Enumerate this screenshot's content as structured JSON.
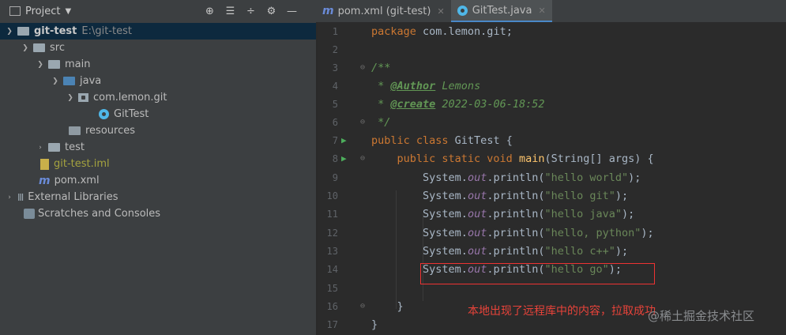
{
  "project_panel": {
    "title": "Project",
    "tools": [
      "⊕",
      "☰",
      "÷",
      "⚙",
      "—"
    ]
  },
  "tabs": [
    {
      "label": "pom.xml (git-test)",
      "active": false
    },
    {
      "label": "GitTest.java",
      "active": true
    }
  ],
  "tree": [
    {
      "label": "git-test",
      "extra": "E:\\git-test"
    },
    {
      "label": "src"
    },
    {
      "label": "main"
    },
    {
      "label": "java"
    },
    {
      "label": "com.lemon.git"
    },
    {
      "label": "GitTest"
    },
    {
      "label": "resources"
    },
    {
      "label": "test"
    },
    {
      "label": "git-test.iml"
    },
    {
      "label": "pom.xml"
    },
    {
      "label": "External Libraries"
    },
    {
      "label": "Scratches and Consoles"
    }
  ],
  "editor": {
    "line_numbers": [
      "1",
      "2",
      "3",
      "4",
      "5",
      "6",
      "7",
      "8",
      "9",
      "10",
      "11",
      "12",
      "13",
      "14",
      "15",
      "16",
      "17"
    ],
    "l1": {
      "kw": "package",
      "rest": " com.lemon.git;"
    },
    "l3": "/**",
    "l4": {
      "star": " * ",
      "tag": "@Author",
      "rest": " Lemons"
    },
    "l5": {
      "star": " * ",
      "tag": "@create",
      "rest": " 2022-03-06-18:52"
    },
    "l6": " */",
    "l7": {
      "kw": "public class",
      "rest": " GitTest {"
    },
    "l8": {
      "kw": "public static void",
      "fn": " main",
      "rest": "(String[] args) {"
    },
    "prints": [
      {
        "obj": "System.",
        "out": "out",
        "call": ".println(",
        "str": "\"hello world\"",
        "end": ");"
      },
      {
        "obj": "System.",
        "out": "out",
        "call": ".println(",
        "str": "\"hello git\"",
        "end": ");"
      },
      {
        "obj": "System.",
        "out": "out",
        "call": ".println(",
        "str": "\"hello java\"",
        "end": ");"
      },
      {
        "obj": "System.",
        "out": "out",
        "call": ".println(",
        "str": "\"hello, python\"",
        "end": ");"
      },
      {
        "obj": "System.",
        "out": "out",
        "call": ".println(",
        "str": "\"hello c++\"",
        "end": ");"
      },
      {
        "obj": "System.",
        "out": "out",
        "call": ".println(",
        "str": "\"hello go\"",
        "end": ");"
      }
    ],
    "l16": "}",
    "l17": "}"
  },
  "annotation": "本地出现了远程库中的内容，拉取成功",
  "watermark": "@稀土掘金技术社区"
}
